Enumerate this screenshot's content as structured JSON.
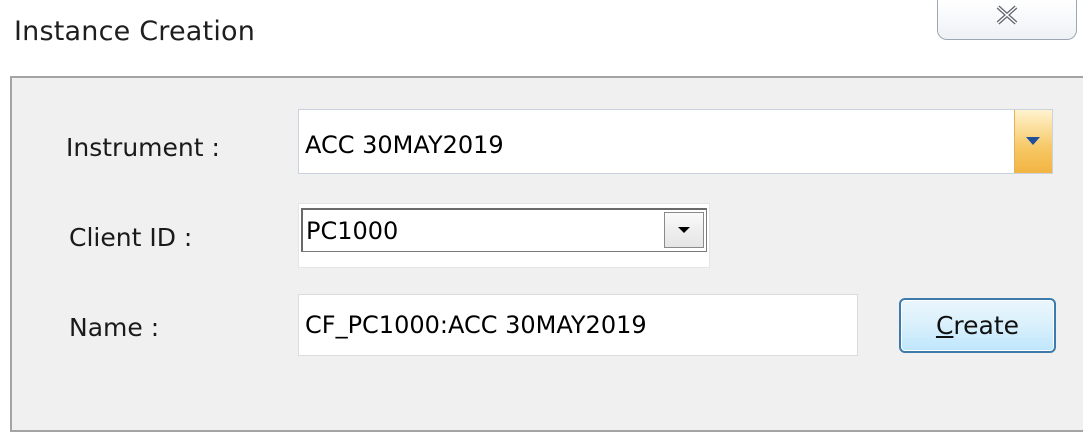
{
  "window": {
    "title": "Instance Creation",
    "close_icon": "close-icon"
  },
  "form": {
    "instrument_label": "Instrument :",
    "instrument_value": "ACC 30MAY2019",
    "client_label": "Client ID :",
    "client_value": "PC1000",
    "name_label": "Name :",
    "name_value": "CF_PC1000:ACC 30MAY2019"
  },
  "buttons": {
    "create_mnemonic": "C",
    "create_rest": "reate"
  },
  "colors": {
    "dropdown_accent": "#f6c865",
    "button_border": "#3d7bad"
  }
}
